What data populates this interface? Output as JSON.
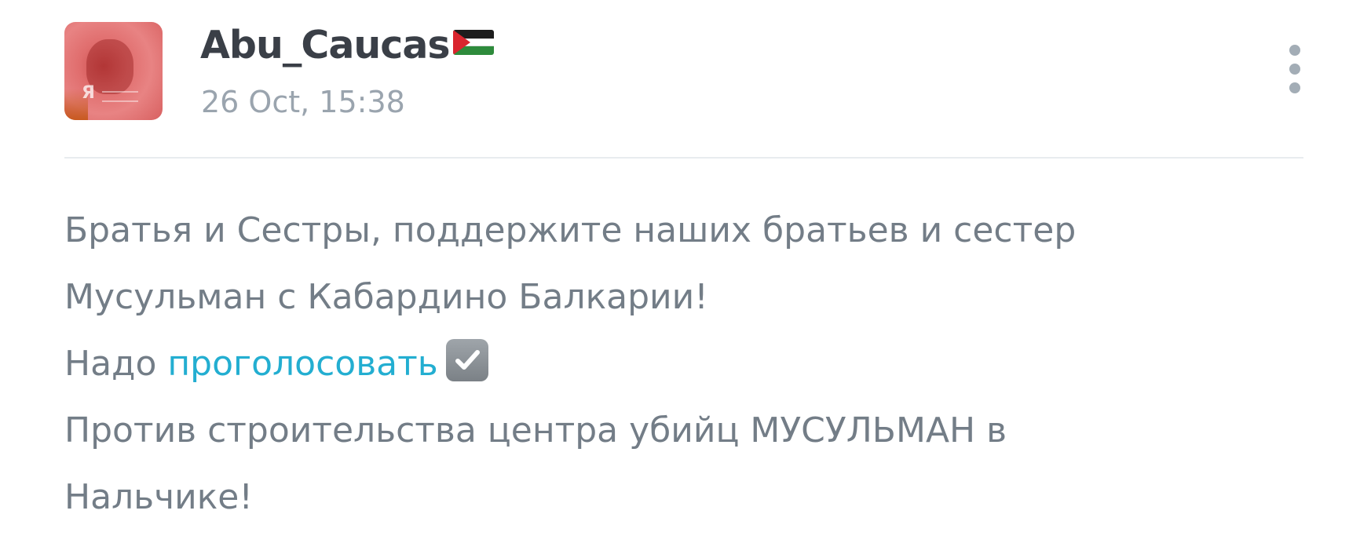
{
  "post": {
    "author": {
      "username": "Abu_Caucas",
      "flag": "palestine-flag-emoji",
      "avatar_watermark": "Я"
    },
    "timestamp": "26 Oct, 15:38",
    "more_icon": "vertical-ellipsis-icon",
    "body": {
      "line1": "Братья и Сестры, поддержите наших братьев и сестер",
      "line2": "Мусульман с Кабардино Балкарии!",
      "line3_prefix": "Надо ",
      "line3_link": "проголосовать",
      "line3_emoji": "check-box-with-check-icon",
      "line4": "Против строительства центра убийц МУСУЛЬМАН в",
      "line5": "Нальчике!"
    }
  },
  "colors": {
    "username": "#3a3f47",
    "timestamp": "#9aa4ae",
    "body_text": "#737d87",
    "link": "#23aed1",
    "divider": "#e8ecef",
    "more_dots": "#a3adb6"
  }
}
